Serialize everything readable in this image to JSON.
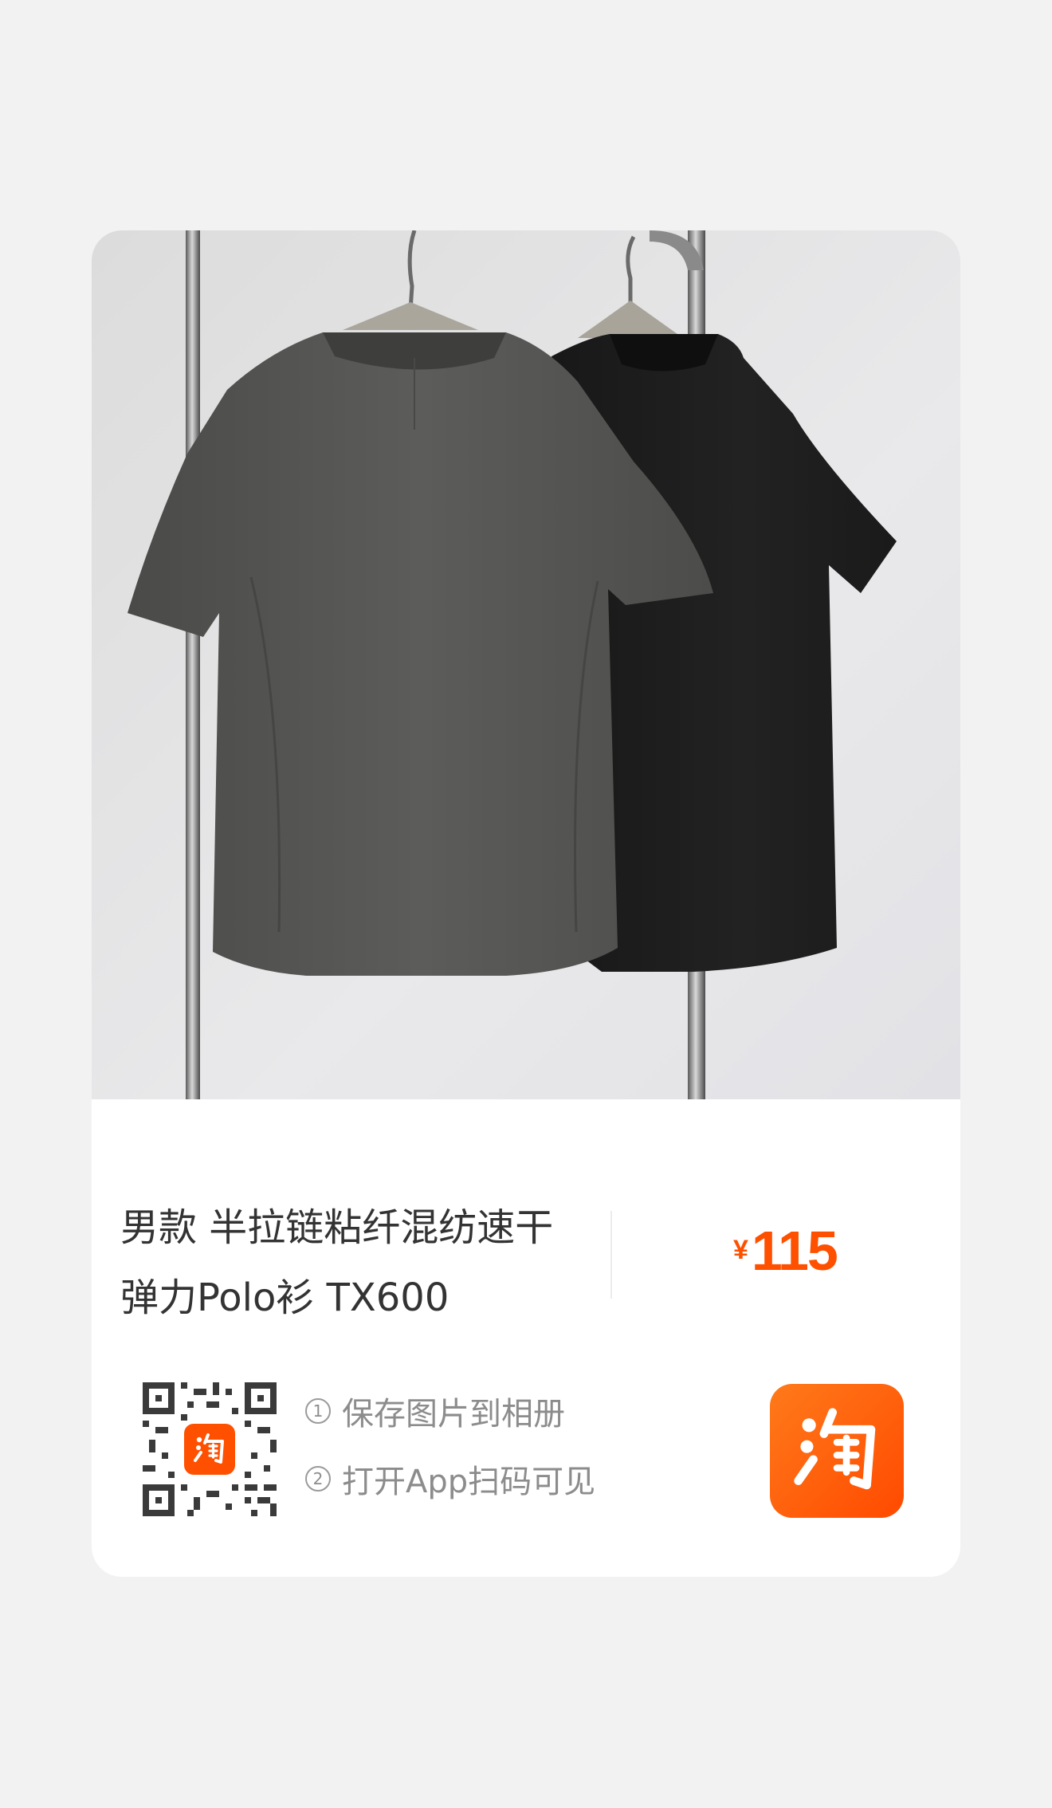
{
  "product": {
    "title": "男款 半拉链粘纤混纺速干\n弹力Polo衫 TX600",
    "price_currency": "¥",
    "price_value": "115",
    "image_icon": "product-photo"
  },
  "share": {
    "step1_number": "1",
    "step1_text": "保存图片到相册",
    "step2_number": "2",
    "step2_text": "打开App扫码可见",
    "qr_badge_icon": "taobao-icon",
    "app_icon": "taobao-app-icon"
  },
  "colors": {
    "background": "#f2f2f2",
    "card": "#ffffff",
    "brand_orange": "#ff5000",
    "title_text": "#333333",
    "muted_text": "#8c8c8c"
  }
}
